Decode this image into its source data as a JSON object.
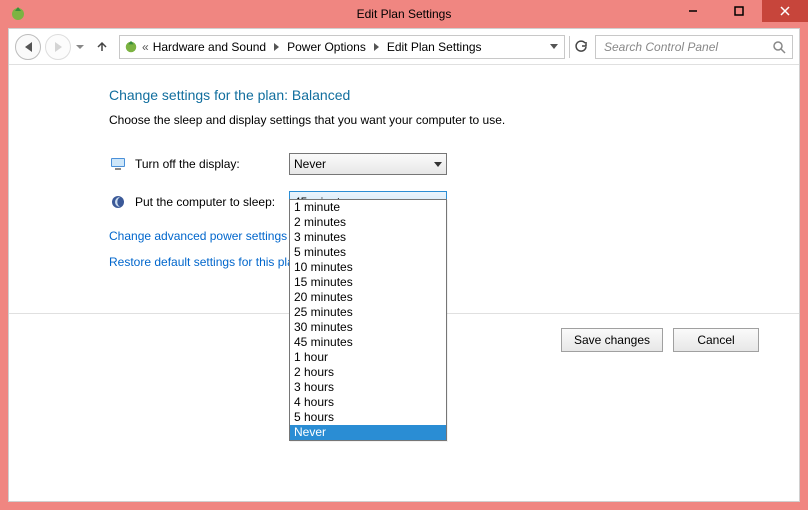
{
  "window": {
    "title": "Edit Plan Settings"
  },
  "breadcrumb": {
    "prefix": "«",
    "items": [
      "Hardware and Sound",
      "Power Options",
      "Edit Plan Settings"
    ]
  },
  "search": {
    "placeholder": "Search Control Panel"
  },
  "page": {
    "heading": "Change settings for the plan: Balanced",
    "sub": "Choose the sleep and display settings that you want your computer to use."
  },
  "settings": {
    "display_off": {
      "label": "Turn off the display:",
      "value": "Never"
    },
    "sleep": {
      "label": "Put the computer to sleep:",
      "value": "45 minutes"
    }
  },
  "links": {
    "advanced": "Change advanced power settings",
    "restore": "Restore default settings for this plan"
  },
  "buttons": {
    "save": "Save changes",
    "cancel": "Cancel"
  },
  "dropdown": {
    "options": [
      "1 minute",
      "2 minutes",
      "3 minutes",
      "5 minutes",
      "10 minutes",
      "15 minutes",
      "20 minutes",
      "25 minutes",
      "30 minutes",
      "45 minutes",
      "1 hour",
      "2 hours",
      "3 hours",
      "4 hours",
      "5 hours",
      "Never"
    ],
    "highlighted": "Never"
  }
}
